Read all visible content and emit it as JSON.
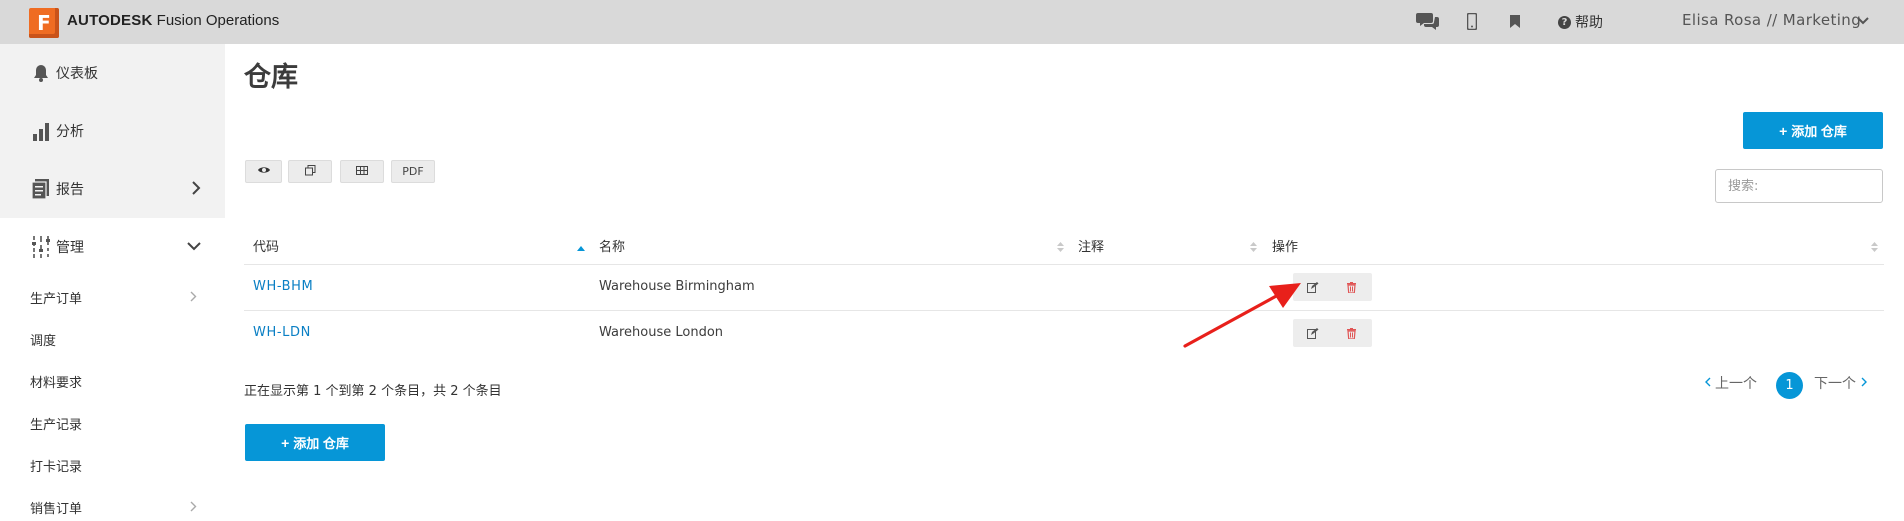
{
  "topbar": {
    "logo_letter": "F",
    "brand_bold": "AUTODESK",
    "brand_rest": " Fusion Operations",
    "help_label": "帮助",
    "user_label": "Elisa Rosa // Marketing",
    "icons": [
      "chat-icon",
      "mobile-icon",
      "bookmark-icon",
      "help-icon",
      "chevron-down-icon"
    ]
  },
  "sidebar": {
    "items": [
      {
        "label": "仪表板",
        "icon": "bell-icon"
      },
      {
        "label": "分析",
        "icon": "bar-chart-icon"
      },
      {
        "label": "报告",
        "icon": "report-icon"
      },
      {
        "label": "管理",
        "icon": "sliders-icon"
      }
    ],
    "sub_items": [
      {
        "label": "生产订单",
        "has_arrow": true
      },
      {
        "label": "调度",
        "has_arrow": false
      },
      {
        "label": "材料要求",
        "has_arrow": false
      },
      {
        "label": "生产记录",
        "has_arrow": false
      },
      {
        "label": "打卡记录",
        "has_arrow": false
      },
      {
        "label": "销售订单",
        "has_arrow": true
      }
    ]
  },
  "main": {
    "title": "仓库",
    "add_button_top": "添加 仓库",
    "add_button_bottom": "添加 仓库",
    "toolbar": {
      "pdf_label": "PDF"
    },
    "search_placeholder": "搜索:",
    "table": {
      "columns": [
        "代码",
        "名称",
        "注释",
        "操作"
      ],
      "rows": [
        {
          "code": "WH-BHM",
          "name": "Warehouse Birmingham",
          "note": ""
        },
        {
          "code": "WH-LDN",
          "name": "Warehouse London",
          "note": ""
        }
      ]
    },
    "info_text": "正在显示第 1 个到第 2 个条目，共 2 个条目",
    "pagination": {
      "prev": "上一个",
      "current": "1",
      "next": "下一个"
    }
  },
  "colors": {
    "accent": "#0696d7",
    "delete": "#e05555",
    "annotation_arrow": "#e8201b",
    "logo": "#ef6c22"
  }
}
